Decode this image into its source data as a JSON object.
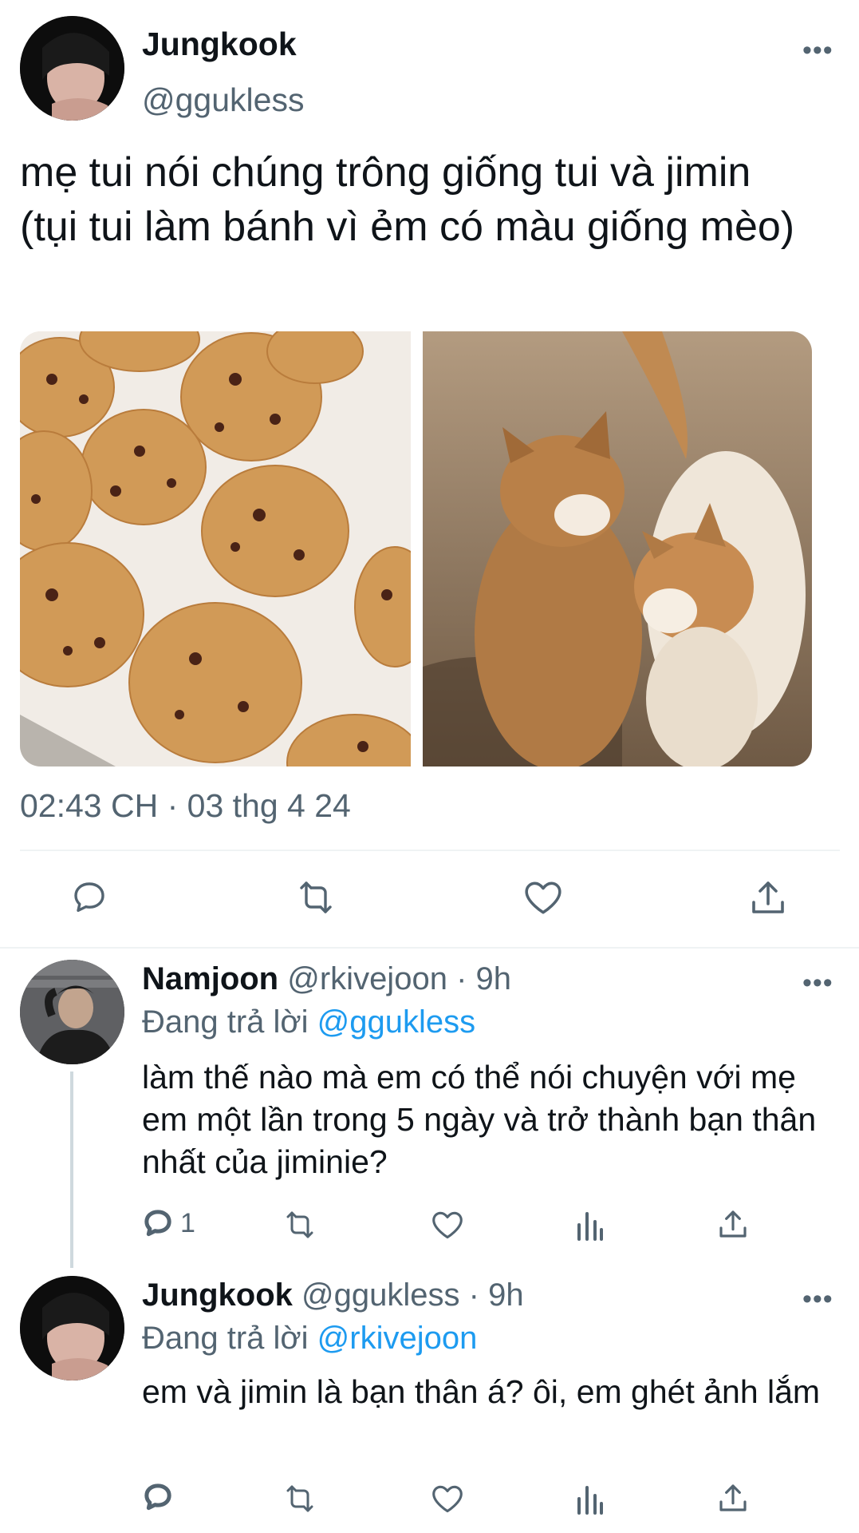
{
  "main_tweet": {
    "author_name": "Jungkook",
    "author_handle": "@ggukless",
    "text": "mẹ tui nói chúng trông giống tui và jimin (tụi tui làm bánh vì ẻm có màu giống mèo)",
    "timestamp": "02:43 CH · 03 thg 4 24",
    "images": [
      "chocolate-chip-cookies-photo",
      "two-orange-cats-photo"
    ]
  },
  "replies": [
    {
      "author_name": "Namjoon",
      "author_handle": "@rkivejoon",
      "time": "· 9h",
      "replying_prefix": "Đang trả lời",
      "replying_to": "@ggukless",
      "text": "làm thế nào mà em có thể nói chuyện với mẹ em một lần trong 5 ngày và trở thành bạn thân nhất của jiminie?",
      "reply_count": "1"
    },
    {
      "author_name": "Jungkook",
      "author_handle": "@ggukless",
      "time": "· 9h",
      "replying_prefix": "Đang trả lời",
      "replying_to": "@rkivejoon",
      "text": "em và jimin là bạn thân á? ôi, em ghét ảnh lắm",
      "reply_count": ""
    }
  ],
  "colors": {
    "accent": "#1d9bf0",
    "muted": "#536471",
    "text": "#0f1419",
    "divider": "#eff3f4"
  }
}
